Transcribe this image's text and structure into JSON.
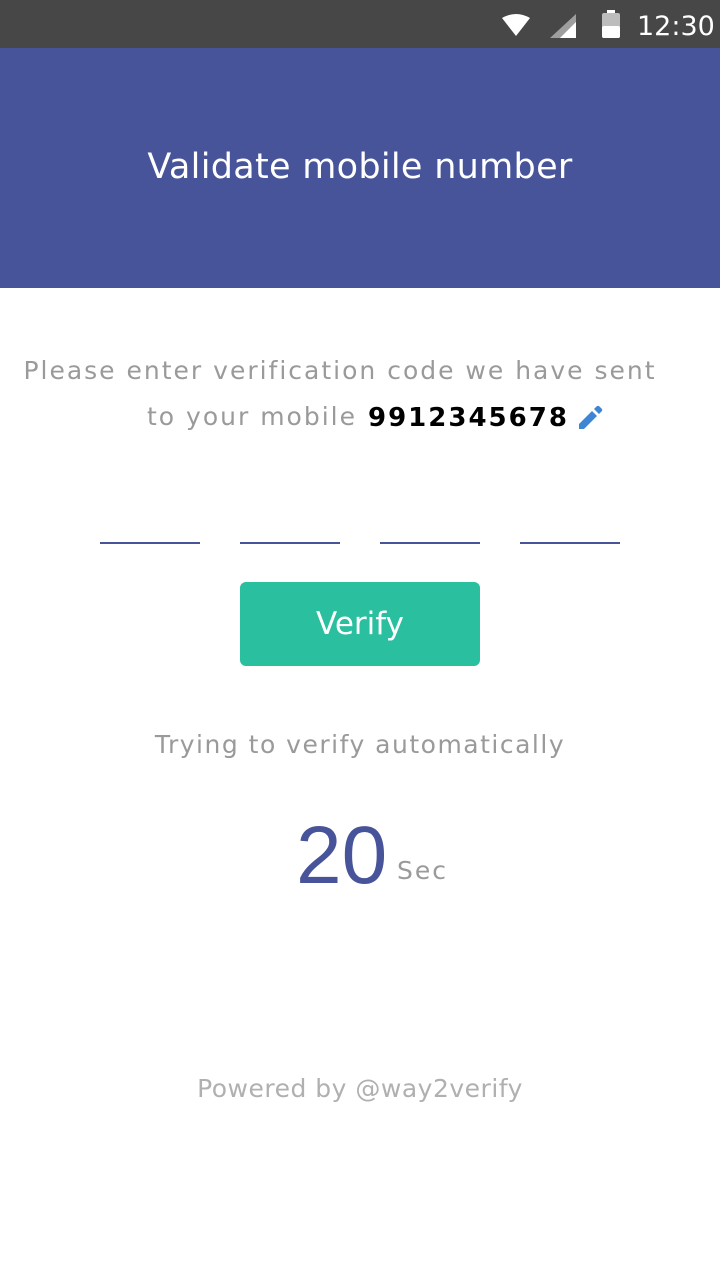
{
  "status_bar": {
    "time": "12:30",
    "icons": [
      "wifi-icon",
      "signal-icon",
      "battery-icon"
    ]
  },
  "header": {
    "title": "Validate mobile number",
    "background_color": "#48549a"
  },
  "instructions": {
    "line1": "Please enter verification code we have sent",
    "line2_label": "to your mobile",
    "phone_number": "9912345678",
    "edit_icon": "pencil-icon"
  },
  "otp": {
    "field_count": 4,
    "values": [
      "",
      "",
      "",
      ""
    ]
  },
  "verify_button": {
    "label": "Verify",
    "color": "#29bf9f"
  },
  "auto_verify": {
    "text": "Trying to verify automatically",
    "countdown": "20",
    "unit": "Sec"
  },
  "footer": {
    "text": "Powered by @way2verify"
  }
}
